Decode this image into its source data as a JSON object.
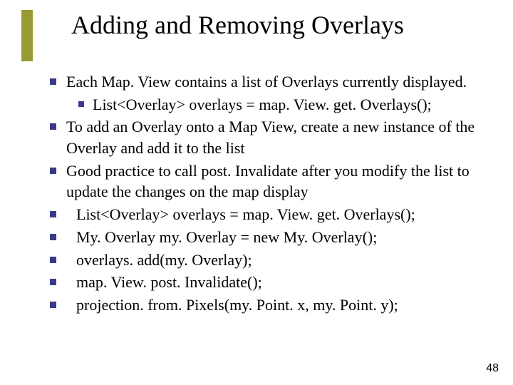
{
  "title": "Adding and Removing Overlays",
  "items": [
    {
      "text": "Each Map. View contains a list of Overlays currently displayed.",
      "sub": [
        {
          "text": "List<Overlay> overlays = map. View. get. Overlays();"
        }
      ]
    },
    {
      "text": "To add an Overlay onto a Map View, create a new instance of the Overlay and add it to the list"
    },
    {
      "text": "Good practice to call  post. Invalidate after you modify the list to update the changes on the map display"
    },
    {
      "text": "List<Overlay> overlays = map. View. get. Overlays();",
      "code": true
    },
    {
      "text": "My. Overlay my. Overlay = new My. Overlay();",
      "code": true
    },
    {
      "text": "overlays. add(my. Overlay);",
      "code": true
    },
    {
      "text": "map. View. post. Invalidate();",
      "code": true
    },
    {
      "text": "projection. from. Pixels(my. Point. x, my. Point. y);",
      "code": true
    }
  ],
  "pageNumber": "48"
}
